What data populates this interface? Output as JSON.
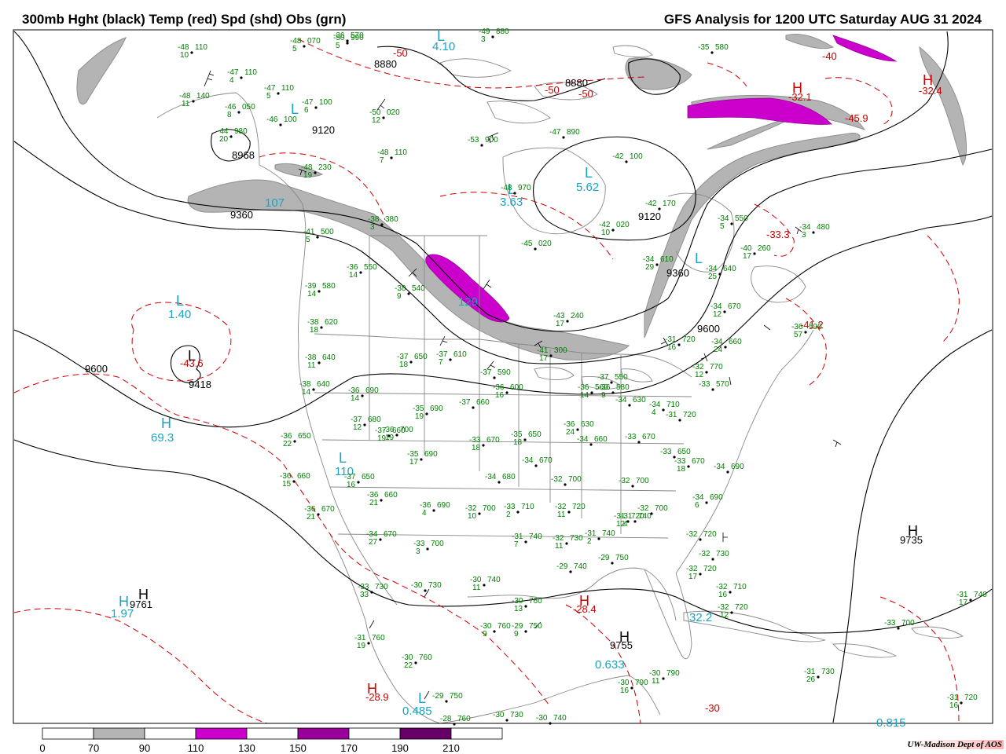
{
  "header": {
    "left_title": "300mb Hght (black) Temp (red) Spd (shd) Obs (grn)",
    "right_title": "GFS Analysis for 1200 UTC Saturday AUG 31 2024"
  },
  "colors": {
    "height": "#000000",
    "temperature": "#cc0000",
    "speed_label": "#1aa3c4",
    "obs": "#008000",
    "political": "#888888",
    "shade_70": "#b4b4b4",
    "shade_110": "#cc00cc",
    "shade_150": "#990099",
    "shade_190": "#660066"
  },
  "height_labels": [
    {
      "text": "9120"
    },
    {
      "text": "8968"
    },
    {
      "text": "9360"
    },
    {
      "text": "8880"
    },
    {
      "text": "8880"
    },
    {
      "text": "9120"
    },
    {
      "text": "9360"
    },
    {
      "text": "9600"
    },
    {
      "text": "9600"
    },
    {
      "text": "9418"
    },
    {
      "text": "9761"
    },
    {
      "text": "9755"
    },
    {
      "text": "9735"
    }
  ],
  "temp_labels": [
    {
      "text": "-43.6"
    },
    {
      "text": "-28.4"
    },
    {
      "text": "-28.9"
    },
    {
      "text": "-41.2"
    },
    {
      "text": "-33.3"
    },
    {
      "text": "-32.1"
    },
    {
      "text": "-32.4"
    },
    {
      "text": "-45.9"
    },
    {
      "text": "-50"
    },
    {
      "text": "-50"
    },
    {
      "text": "-50"
    },
    {
      "text": "-30"
    },
    {
      "text": "-40"
    }
  ],
  "speed_labels": [
    {
      "text": "1.40"
    },
    {
      "text": "69.3"
    },
    {
      "text": "1.97"
    },
    {
      "text": "0.633"
    },
    {
      "text": "0.485"
    },
    {
      "text": "32.2"
    },
    {
      "text": "129"
    },
    {
      "text": "3.63"
    },
    {
      "text": "5.62"
    },
    {
      "text": "4.10"
    },
    {
      "text": "107"
    },
    {
      "text": "110"
    },
    {
      "text": "0.815"
    }
  ],
  "hl_letters": [
    {
      "text": "L"
    },
    {
      "text": "L"
    },
    {
      "text": "H"
    },
    {
      "text": "H"
    },
    {
      "text": "H"
    },
    {
      "text": "H"
    },
    {
      "text": "L"
    },
    {
      "text": "H"
    },
    {
      "text": "L"
    },
    {
      "text": "L"
    },
    {
      "text": "L"
    },
    {
      "text": "L"
    },
    {
      "text": "H"
    },
    {
      "text": "H"
    },
    {
      "text": "L"
    },
    {
      "text": "L"
    },
    {
      "text": "H"
    },
    {
      "text": "H"
    }
  ],
  "observations": [
    {
      "t": "-48",
      "h": "110",
      "d": "10"
    },
    {
      "t": "-47",
      "h": "110",
      "d": "4"
    },
    {
      "t": "-47",
      "h": "110",
      "d": "5"
    },
    {
      "t": "-48",
      "h": "140",
      "d": "11"
    },
    {
      "t": "-46",
      "h": "050",
      "d": "8"
    },
    {
      "t": "-46",
      "h": "100",
      "d": ""
    },
    {
      "t": "-47",
      "h": "100",
      "d": "6"
    },
    {
      "t": "-44",
      "h": "980",
      "d": "20"
    },
    {
      "t": "-50",
      "h": "990",
      "d": "5"
    },
    {
      "t": "-48",
      "h": "070",
      "d": "5"
    },
    {
      "t": "-50",
      "h": "020",
      "d": "12"
    },
    {
      "t": "-48",
      "h": "110",
      "d": "7"
    },
    {
      "t": "-53",
      "h": "900",
      "d": ""
    },
    {
      "t": "-47",
      "h": "890",
      "d": ""
    },
    {
      "t": "-48",
      "h": "970",
      "d": ""
    },
    {
      "t": "-42",
      "h": "100",
      "d": ""
    },
    {
      "t": "-42",
      "h": "170",
      "d": ""
    },
    {
      "t": "-42",
      "h": "020",
      "d": "10"
    },
    {
      "t": "-45",
      "h": "020",
      "d": ""
    },
    {
      "t": "-38",
      "h": "380",
      "d": "3"
    },
    {
      "t": "-48",
      "h": "230",
      "d": "19"
    },
    {
      "t": "-41",
      "h": "500",
      "d": "5"
    },
    {
      "t": "-36",
      "h": "550",
      "d": "14"
    },
    {
      "t": "-38",
      "h": "540",
      "d": "9"
    },
    {
      "t": "-39",
      "h": "580",
      "d": "14"
    },
    {
      "t": "-38",
      "h": "620",
      "d": "18"
    },
    {
      "t": "-38",
      "h": "640",
      "d": "11"
    },
    {
      "t": "-38",
      "h": "640",
      "d": "14"
    },
    {
      "t": "-36",
      "h": "690",
      "d": "14"
    },
    {
      "t": "-37",
      "h": "650",
      "d": "18"
    },
    {
      "t": "-37",
      "h": "610",
      "d": "7"
    },
    {
      "t": "-37",
      "h": "590",
      "d": ""
    },
    {
      "t": "-36",
      "h": "600",
      "d": "16"
    },
    {
      "t": "-37",
      "h": "660",
      "d": ""
    },
    {
      "t": "-35",
      "h": "690",
      "d": "19"
    },
    {
      "t": "-37",
      "h": "680",
      "d": "12"
    },
    {
      "t": "-37",
      "h": "660",
      "d": "19"
    },
    {
      "t": "-36",
      "h": "700",
      "d": "19"
    },
    {
      "t": "-36",
      "h": "650",
      "d": "22"
    },
    {
      "t": "-35",
      "h": "690",
      "d": "17"
    },
    {
      "t": "-33",
      "h": "670",
      "d": "18"
    },
    {
      "t": "-35",
      "h": "650",
      "d": "18"
    },
    {
      "t": "-36",
      "h": "660",
      "d": "15"
    },
    {
      "t": "-37",
      "h": "650",
      "d": "16"
    },
    {
      "t": "-34",
      "h": "680",
      "d": ""
    },
    {
      "t": "-34",
      "h": "670",
      "d": ""
    },
    {
      "t": "-36",
      "h": "670",
      "d": "21"
    },
    {
      "t": "-36",
      "h": "660",
      "d": "21"
    },
    {
      "t": "-36",
      "h": "690",
      "d": "4"
    },
    {
      "t": "-34",
      "h": "670",
      "d": "27"
    },
    {
      "t": "-33",
      "h": "700",
      "d": "3"
    },
    {
      "t": "-32",
      "h": "700",
      "d": "10"
    },
    {
      "t": "-33",
      "h": "710",
      "d": "2"
    },
    {
      "t": "-32",
      "h": "700",
      "d": ""
    },
    {
      "t": "-32",
      "h": "720",
      "d": "11"
    },
    {
      "t": "-31",
      "h": "720",
      "d": "12"
    },
    {
      "t": "-31",
      "h": "740",
      "d": "7"
    },
    {
      "t": "-31",
      "h": "740",
      "d": "4"
    },
    {
      "t": "-32",
      "h": "730",
      "d": "11"
    },
    {
      "t": "-31",
      "h": "740",
      "d": "2"
    },
    {
      "t": "-33",
      "h": "730",
      "d": "33"
    },
    {
      "t": "-30",
      "h": "730",
      "d": ""
    },
    {
      "t": "-30",
      "h": "740",
      "d": "11"
    },
    {
      "t": "-30",
      "h": "760",
      "d": "13"
    },
    {
      "t": "-29",
      "h": "740",
      "d": ""
    },
    {
      "t": "-29",
      "h": "750",
      "d": ""
    },
    {
      "t": "-30",
      "h": "760",
      "d": "9"
    },
    {
      "t": "-29",
      "h": "750",
      "d": "9"
    },
    {
      "t": "-31",
      "h": "760",
      "d": "19"
    },
    {
      "t": "-30",
      "h": "760",
      "d": "22"
    },
    {
      "t": "-29",
      "h": "750",
      "d": ""
    },
    {
      "t": "-28",
      "h": "760",
      "d": ""
    },
    {
      "t": "-30",
      "h": "730",
      "d": ""
    },
    {
      "t": "-30",
      "h": "740",
      "d": ""
    },
    {
      "t": "-30",
      "h": "790",
      "d": "16"
    },
    {
      "t": "-30",
      "h": "790",
      "d": "11"
    },
    {
      "t": "-43",
      "h": "240",
      "d": "17"
    },
    {
      "t": "-41",
      "h": "300",
      "d": "17"
    },
    {
      "t": "-37",
      "h": "550",
      "d": ""
    },
    {
      "t": "-36",
      "h": "580",
      "d": "9"
    },
    {
      "t": "-36",
      "h": "560",
      "d": "14"
    },
    {
      "t": "-34",
      "h": "630",
      "d": ""
    },
    {
      "t": "-36",
      "h": "630",
      "d": "24"
    },
    {
      "t": "-34",
      "h": "660",
      "d": ""
    },
    {
      "t": "-33",
      "h": "670",
      "d": ""
    },
    {
      "t": "-34",
      "h": "710",
      "d": "4"
    },
    {
      "t": "-32",
      "h": "700",
      "d": ""
    },
    {
      "t": "-33",
      "h": "650",
      "d": ""
    },
    {
      "t": "-33",
      "h": "670",
      "d": "18"
    },
    {
      "t": "-34",
      "h": "690",
      "d": ""
    },
    {
      "t": "-34",
      "h": "690",
      "d": "6"
    },
    {
      "t": "-32",
      "h": "700",
      "d": ""
    },
    {
      "t": "-32",
      "h": "720",
      "d": ""
    },
    {
      "t": "-32",
      "h": "730",
      "d": ""
    },
    {
      "t": "-32",
      "h": "720",
      "d": "17"
    },
    {
      "t": "-32",
      "h": "710",
      "d": "16"
    },
    {
      "t": "-32",
      "h": "720",
      "d": "12"
    },
    {
      "t": "-31",
      "h": "720",
      "d": ""
    },
    {
      "t": "-31",
      "h": "740",
      "d": "17"
    },
    {
      "t": "-33",
      "h": "700",
      "d": ""
    },
    {
      "t": "-31",
      "h": "730",
      "d": "26"
    },
    {
      "t": "-31",
      "h": "720",
      "d": "16"
    },
    {
      "t": "-31",
      "h": "720",
      "d": "16"
    },
    {
      "t": "-32",
      "h": "770",
      "d": "12"
    },
    {
      "t": "-33",
      "h": "570",
      "d": ""
    },
    {
      "t": "-34",
      "h": "660",
      "d": "24"
    },
    {
      "t": "-34",
      "h": "670",
      "d": "12"
    },
    {
      "t": "-34",
      "h": "640",
      "d": "25"
    },
    {
      "t": "-34",
      "h": "610",
      "d": "29"
    },
    {
      "t": "-34",
      "h": "550",
      "d": "5"
    },
    {
      "t": "-40",
      "h": "260",
      "d": "17"
    },
    {
      "t": "-34",
      "h": "480",
      "d": "3"
    },
    {
      "t": "-36",
      "h": "590",
      "d": "57"
    },
    {
      "t": "-35",
      "h": "580",
      "d": ""
    },
    {
      "t": "-36",
      "h": "570",
      "d": ""
    },
    {
      "t": "-49",
      "h": "880",
      "d": "3"
    },
    {
      "t": "-49",
      "h": "990",
      "d": ""
    },
    {
      "t": "-50",
      "h": "990",
      "d": ""
    }
  ],
  "legend": {
    "values": [
      "0",
      "70",
      "90",
      "110",
      "130",
      "150",
      "170",
      "190",
      "210"
    ]
  },
  "credit": "UW-Madison   Dept of AOS"
}
